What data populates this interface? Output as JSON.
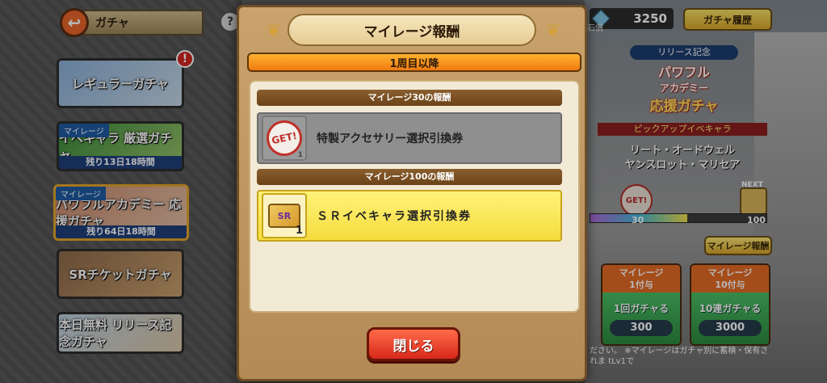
{
  "header": {
    "back_icon": "back-arrow-icon",
    "title": "ガチャ",
    "help": "?"
  },
  "banners": [
    {
      "tag": "",
      "text": "レギュラーガチャ",
      "footer": "",
      "alert": "!"
    },
    {
      "tag": "マイレージ",
      "text": "イベキャラ 厳選ガチャ",
      "footer": "残り13日18時間"
    },
    {
      "tag": "マイレージ",
      "text": "パワフルアカデミー 応援ガチャ",
      "footer": "残り64日18時間"
    },
    {
      "tag": "",
      "text": "SRチケットガチャ",
      "footer": ""
    },
    {
      "tag": "",
      "text": "本日無料 リリース記念ガチャ",
      "footer": ""
    }
  ],
  "right": {
    "currency_value": "3250",
    "currency_label": "石償",
    "history_button": "ガチャ履歴",
    "release_tag": "リリース記念",
    "logo_line1": "パワフル",
    "logo_line2": "アカデミー",
    "logo_line3": "応援ガチャ",
    "pickup_label": "ピックアップイベキャラ",
    "pickup_name1": "リート・オードウェル",
    "pickup_name2": "ヤンスロット・マリセア",
    "progress_current": "30",
    "progress_next": "100",
    "progress_fraction": 0.55,
    "next_label": "NEXT",
    "get_label": "GET!",
    "mileage_button": "マイレージ報酬",
    "tiles": [
      {
        "head1": "マイレージ",
        "head2": "1付与",
        "label": "1回ガチャる",
        "cost": "300"
      },
      {
        "head1": "マイレージ",
        "head2": "10付与",
        "label": "10連ガチャる",
        "cost": "3000"
      }
    ],
    "notice": "ださい。 ※マイレージはガチャ別に蓄積・保有されま tLv1で"
  },
  "modal": {
    "title": "マイレージ報酬",
    "round_label": "1周目以降",
    "rewards": [
      {
        "header": "マイレージ30の報酬",
        "icon": "get-stamp-icon",
        "icon_text": "GET!",
        "qty": "1",
        "name": "特製アクセサリー選択引換券"
      },
      {
        "header": "マイレージ100の報酬",
        "icon": "sr-ticket-icon",
        "icon_text": "SR",
        "qty": "1",
        "name": "ＳＲイベキャラ選択引換券"
      }
    ],
    "close_button": "閉じる"
  }
}
